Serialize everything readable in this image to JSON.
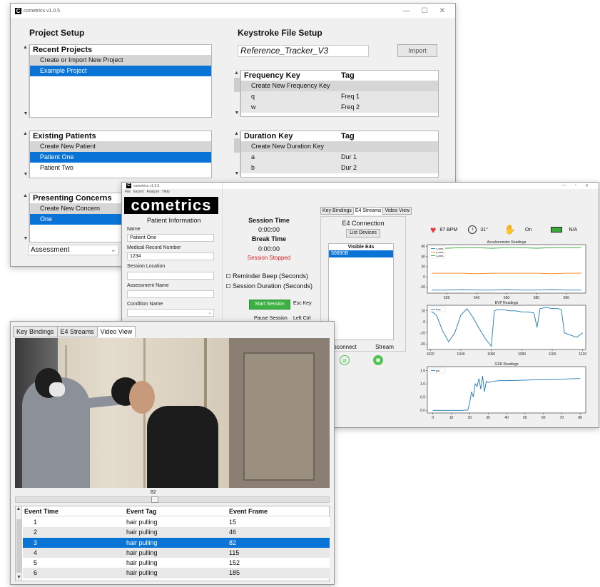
{
  "win1": {
    "title": "cometrics v1.0.5",
    "project_setup": {
      "title": "Project Setup",
      "recent_projects": {
        "header": "Recent Projects",
        "items": [
          "Create or Import New Project",
          "Example Project"
        ]
      },
      "existing_patients": {
        "header": "Existing Patients",
        "items": [
          "Create New Patient",
          "Patient One",
          "Patient Two"
        ]
      },
      "presenting_concerns": {
        "header": "Presenting Concerns",
        "items": [
          "Create New Concern",
          "One"
        ]
      },
      "assessment_select": "Assessment"
    },
    "keystroke_setup": {
      "title": "Keystroke File Setup",
      "file_name": "Reference_Tracker_V3",
      "import_label": "Import",
      "frequency": {
        "header": "Frequency Key",
        "tag_header": "Tag",
        "create": "Create New Frequency Key",
        "rows": [
          [
            "q",
            "Freq 1"
          ],
          [
            "w",
            "Freq 2"
          ]
        ]
      },
      "duration": {
        "header": "Duration Key",
        "tag_header": "Tag",
        "create": "Create New Duration Key",
        "rows": [
          [
            "a",
            "Dur 1"
          ],
          [
            "b",
            "Dur 2"
          ]
        ]
      }
    }
  },
  "win2": {
    "title": "cometrics v1.0.5",
    "menu": [
      "File",
      "Export",
      "Analyze",
      "Help"
    ],
    "brand": "cometrics",
    "patient_info": {
      "title": "Patient Information",
      "name_label": "Name",
      "name_value": "Patient One",
      "mrn_label": "Medical Record Number",
      "mrn_value": "1234",
      "location_label": "Session Location",
      "assessment_label": "Assessment Name",
      "condition_label": "Condition Name"
    },
    "session": {
      "session_time_label": "Session Time",
      "session_time": "0:00:00",
      "break_time_label": "Break Time",
      "break_time": "0:00:00",
      "status": "Session Stopped",
      "reminder_beep": "Reminder Beep (Seconds)",
      "session_duration": "Session Duration (Seconds)",
      "start_label": "Start Session",
      "start_key": "Esc Key",
      "pause_label": "Pause Session",
      "pause_key": "Left Ctrl"
    },
    "tabs": [
      "Key Bindings",
      "E4 Streams",
      "Video View"
    ],
    "e4": {
      "title": "E4 Connection",
      "list_devices": "List Devices",
      "visible_header": "Visible E4s",
      "devices": [
        "30890B"
      ],
      "disconnect": "Disconnect",
      "stream": "Stream"
    },
    "status_bar": {
      "heart_rate": "87 BPM",
      "temperature": "31°",
      "on_wrist": "On",
      "battery": "N/A"
    },
    "colors": {
      "heart": "#e23b3b",
      "hand": "#4fc24f",
      "battery": "#3aa83a"
    }
  },
  "win3": {
    "tabs": [
      "Key Bindings",
      "E4 Streams",
      "Video View"
    ],
    "frame_value": "82",
    "video_progress": 0.44,
    "table": {
      "headers": [
        "Event Time",
        "Event Tag",
        "Event Frame"
      ],
      "rows": [
        [
          "1",
          "hair pulling",
          "15"
        ],
        [
          "2",
          "hair pulling",
          "46"
        ],
        [
          "3",
          "hair pulling",
          "82"
        ],
        [
          "4",
          "hair pulling",
          "115"
        ],
        [
          "5",
          "hair pulling",
          "152"
        ],
        [
          "6",
          "hair pulling",
          "185"
        ]
      ],
      "selected_index": 2
    }
  },
  "chart_data": [
    {
      "type": "line",
      "title": "Accelerometer Readings",
      "x": [
        510,
        520,
        530,
        540,
        550,
        560,
        570,
        580,
        590,
        600,
        610
      ],
      "series": [
        {
          "name": "x-axis",
          "color": "#1f77b4",
          "values": [
            -26,
            -26,
            -25,
            -26,
            -26,
            -25,
            -26,
            -26,
            -25,
            -26,
            -26
          ]
        },
        {
          "name": "y-axis",
          "color": "#ff7f0e",
          "values": [
            7,
            7,
            7,
            6,
            7,
            7,
            7,
            7,
            6,
            7,
            7
          ]
        },
        {
          "name": "z-axis",
          "color": "#2ca02c",
          "values": [
            57,
            56,
            57,
            57,
            56,
            57,
            57,
            56,
            57,
            57,
            57
          ]
        }
      ],
      "xticks": [
        520,
        540,
        560,
        580,
        600
      ],
      "yticks": [
        -20,
        0,
        20,
        40,
        60
      ],
      "xlim": [
        507,
        613
      ],
      "ylim": [
        -32,
        63
      ],
      "legend": "top-left"
    },
    {
      "type": "line",
      "title": "BVP Readings",
      "x": [
        1020,
        1024,
        1028,
        1032,
        1036,
        1040,
        1044,
        1048,
        1052,
        1056,
        1060,
        1062,
        1064,
        1068,
        1072,
        1076,
        1080,
        1084,
        1088,
        1090,
        1092,
        1096,
        1100,
        1104,
        1106,
        1108,
        1112,
        1116,
        1120
      ],
      "series": [
        {
          "name": "bvp",
          "color": "#1f77b4",
          "values": [
            10,
            6,
            -8,
            -18,
            -10,
            6,
            12,
            4,
            -6,
            -15,
            -22,
            10,
            11,
            11,
            10,
            10,
            9,
            9,
            8,
            -5,
            12,
            13,
            12,
            12,
            11,
            -10,
            -12,
            -14,
            -10
          ]
        }
      ],
      "xticks": [
        1020,
        1040,
        1060,
        1080,
        1100,
        1120
      ],
      "yticks": [
        -20,
        -10,
        0,
        10
      ],
      "xlim": [
        1018,
        1122
      ],
      "ylim": [
        -25,
        15
      ],
      "legend": "top-left"
    },
    {
      "type": "line",
      "title": "GSR Readings",
      "x": [
        0,
        5,
        10,
        15,
        19,
        20,
        21,
        22,
        23,
        24,
        25,
        26,
        27,
        28,
        29,
        30,
        33,
        36,
        40,
        45,
        50,
        55,
        60,
        65,
        70,
        75,
        80
      ],
      "series": [
        {
          "name": "gsr",
          "color": "#1f77b4",
          "values": [
            0.0,
            0.0,
            0.0,
            0.0,
            0.01,
            0.3,
            0.7,
            0.5,
            1.0,
            0.9,
            1.2,
            0.8,
            1.3,
            0.7,
            1.1,
            1.05,
            1.1,
            1.12,
            1.12,
            1.13,
            1.14,
            1.15,
            1.15,
            1.16,
            1.17,
            1.19,
            1.2
          ]
        }
      ],
      "xticks": [
        0,
        10,
        20,
        30,
        40,
        50,
        60,
        70,
        80
      ],
      "yticks": [
        0.0,
        0.5,
        1.0,
        1.5
      ],
      "xlim": [
        -3,
        83
      ],
      "ylim": [
        -0.1,
        1.65
      ],
      "legend": "top-left"
    }
  ]
}
